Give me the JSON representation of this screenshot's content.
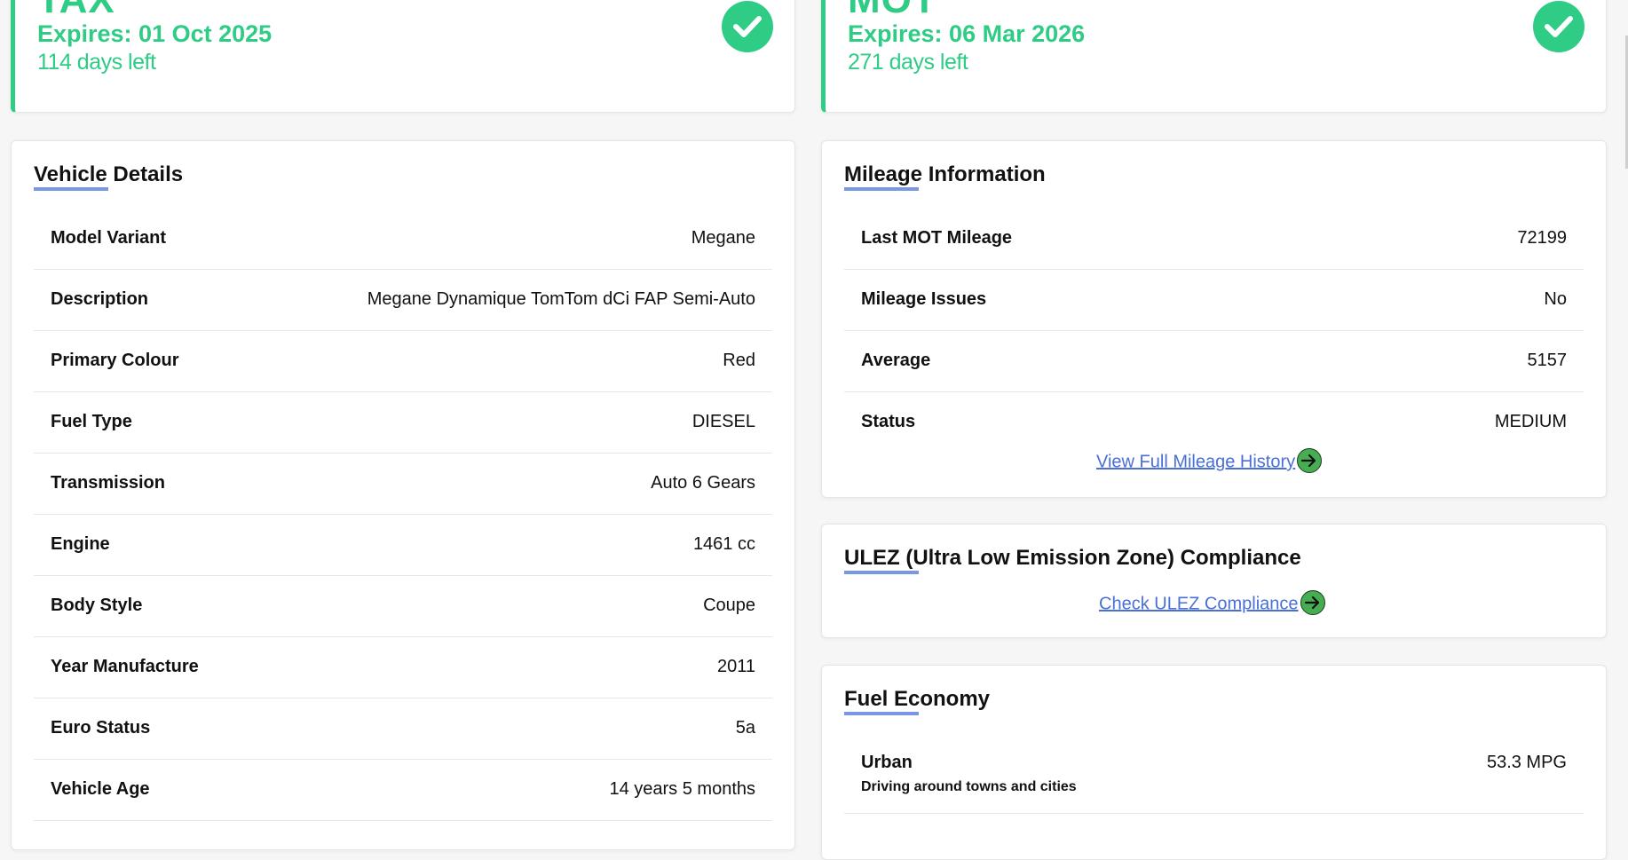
{
  "tax": {
    "heading": "TAX",
    "expires": "Expires: 01 Oct 2025",
    "days_left": "114 days left"
  },
  "mot": {
    "heading": "MOT",
    "expires": "Expires: 06 Mar 2026",
    "days_left": "271 days left"
  },
  "vehicle_details": {
    "title": "Vehicle Details",
    "rows": [
      {
        "label": "Model Variant",
        "value": "Megane"
      },
      {
        "label": "Description",
        "value": "Megane Dynamique TomTom dCi FAP Semi-Auto"
      },
      {
        "label": "Primary Colour",
        "value": "Red"
      },
      {
        "label": "Fuel Type",
        "value": "DIESEL"
      },
      {
        "label": "Transmission",
        "value": "Auto 6 Gears"
      },
      {
        "label": "Engine",
        "value": "1461 cc"
      },
      {
        "label": "Body Style",
        "value": "Coupe"
      },
      {
        "label": "Year Manufacture",
        "value": "2011"
      },
      {
        "label": "Euro Status",
        "value": "5a"
      },
      {
        "label": "Vehicle Age",
        "value": "14 years 5 months"
      }
    ]
  },
  "mileage": {
    "title": "Mileage Information",
    "rows": [
      {
        "label": "Last MOT Mileage",
        "value": "72199"
      },
      {
        "label": "Mileage Issues",
        "value": "No"
      },
      {
        "label": "Average",
        "value": "5157"
      },
      {
        "label": "Status",
        "value": "MEDIUM"
      }
    ],
    "link": "View Full Mileage History"
  },
  "ulez": {
    "title": "ULEZ (Ultra Low Emission Zone) Compliance",
    "link": "Check ULEZ Compliance"
  },
  "fuel_economy": {
    "title": "Fuel Economy",
    "rows": [
      {
        "label": "Urban",
        "sub": "Driving around towns and cities",
        "value": "53.3 MPG"
      }
    ]
  },
  "icons": {
    "check": "check-circle-icon",
    "arrow": "arrow-right-circle-icon"
  },
  "colors": {
    "accent_green": "#2ecc85",
    "link_blue": "#4a6fd6",
    "underline_blue": "#7a97e6",
    "arrow_green": "#46ad52"
  }
}
